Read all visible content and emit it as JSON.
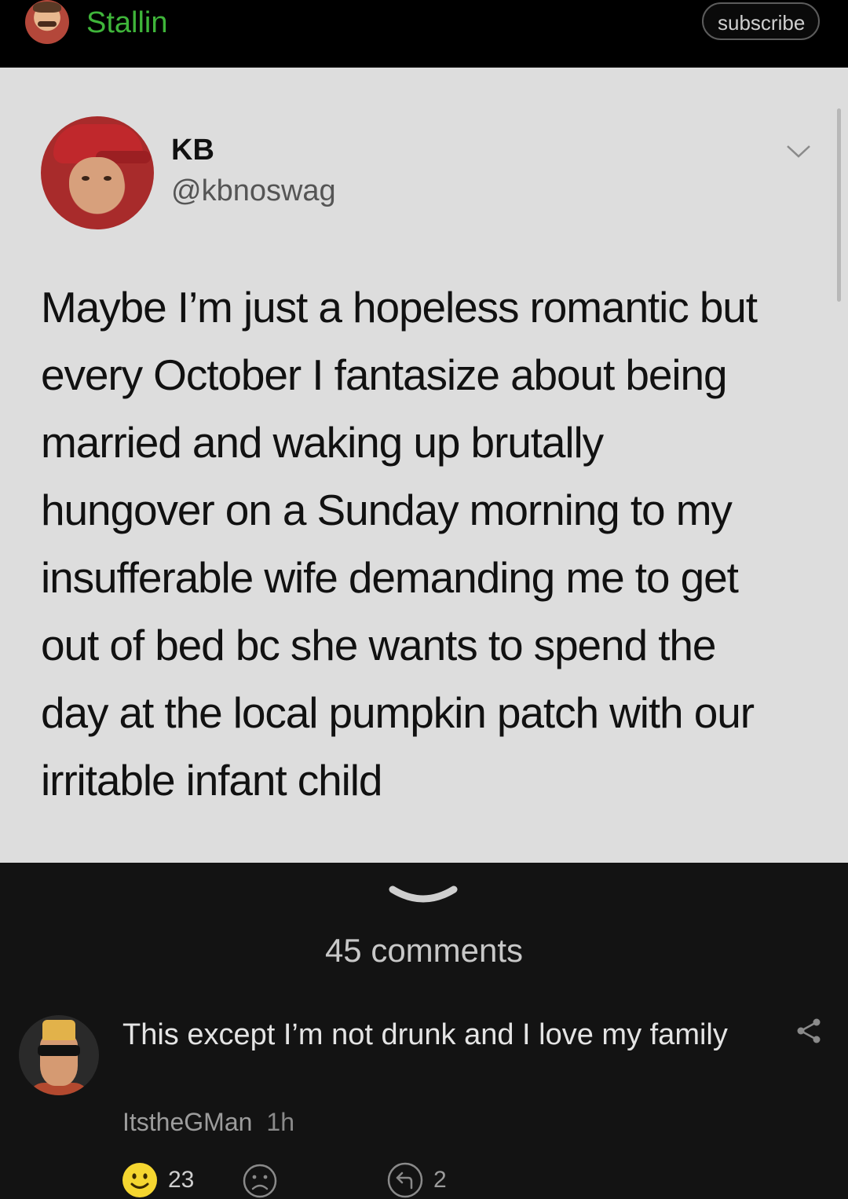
{
  "header": {
    "channel_name": "Stallin",
    "subscribe_label": "subscribe"
  },
  "tweet": {
    "author_name": "KB",
    "author_handle": "@kbnoswag",
    "text": "Maybe I’m just a hopeless romantic but every October I fantasize about being married and waking up brutally hungover on a Sunday morning to my insufferable wife demanding me to get out of bed bc she wants to spend the day at the local pumpkin patch with our irritable infant child",
    "text_lines": [
      "Maybe I’m just a hopeless romantic but",
      "every October I fantasize about being",
      "married and waking up brutally",
      "hungover on a Sunday morning to my",
      "insufferable wife demanding me to get",
      "out of bed bc she wants to spend the",
      "day at the local pumpkin patch with our",
      "irritable infant child"
    ]
  },
  "comments_section": {
    "count_label": "45 comments"
  },
  "comment": {
    "text": "This except I’m not drunk and I love my family",
    "author": "ItstheGMan",
    "time": "1h",
    "upvotes": "23",
    "replies": "2"
  },
  "colors": {
    "channel_green": "#3fb53a",
    "tweet_bg": "#dddddd",
    "dark_bg": "#131313",
    "emoji_yellow": "#f5d630"
  }
}
